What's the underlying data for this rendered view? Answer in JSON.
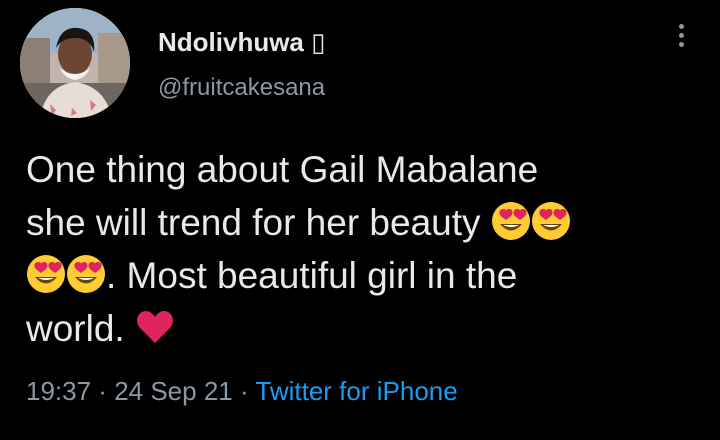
{
  "user": {
    "display_name": "Ndolivhuwa ▯",
    "handle": "@fruitcakesana",
    "avatar": "profile-photo"
  },
  "tweet": {
    "line1": "One thing about Gail Mabalane",
    "line2": "she will trend for her beauty ",
    "line3": ". Most beautiful girl in the",
    "line4": "world. ",
    "emojis": [
      "heart-eyes-emoji",
      "heart-eyes-emoji",
      "heart-eyes-emoji",
      "heart-eyes-emoji",
      "red-heart-emoji"
    ]
  },
  "meta": {
    "time": "19:37",
    "sep1": " · ",
    "date": "24 Sep 21",
    "sep2": " · ",
    "source": "Twitter for iPhone"
  },
  "colors": {
    "background": "#000000",
    "text": "#e7e9ea",
    "secondary": "#8b98a5",
    "link": "#1d9bf0",
    "heart": "#e0245e"
  },
  "icons": {
    "more": "more-vertical-icon"
  }
}
